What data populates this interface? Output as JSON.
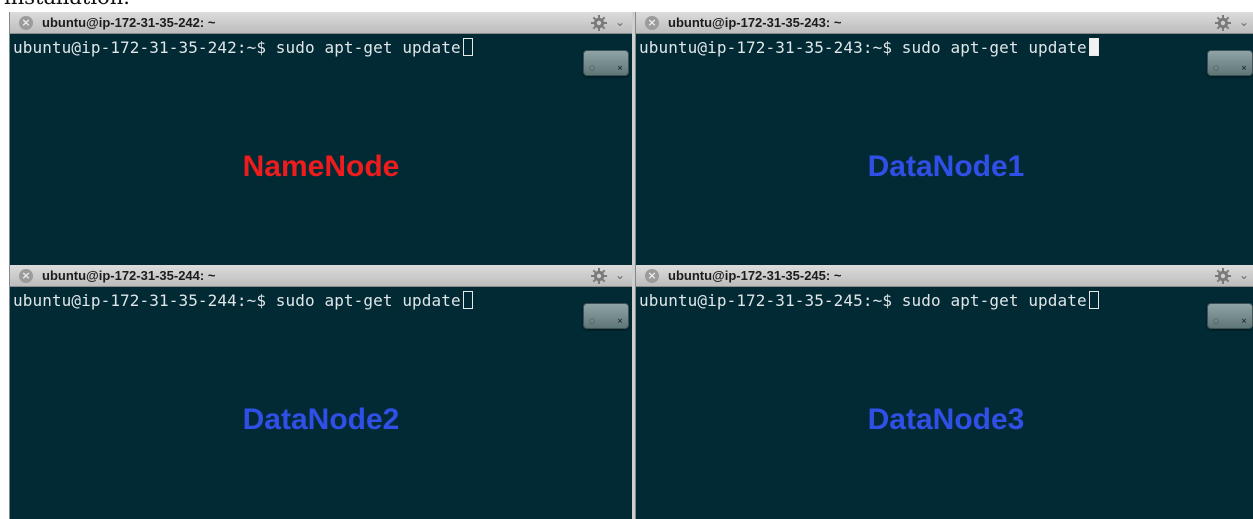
{
  "caption": {
    "partial_text": "installation."
  },
  "panes": [
    {
      "title": "ubuntu@ip-172-31-35-242: ~",
      "prompt": "ubuntu@ip-172-31-35-242:~$",
      "command": "sudo apt-get update",
      "cursor": "outline",
      "label": "NameNode",
      "label_color": "#ee1c1c"
    },
    {
      "title": "ubuntu@ip-172-31-35-243: ~",
      "prompt": "ubuntu@ip-172-31-35-243:~$",
      "command": "sudo apt-get update",
      "cursor": "filled",
      "label": "DataNode1",
      "label_color": "#2f4fe6"
    },
    {
      "title": "ubuntu@ip-172-31-35-244: ~",
      "prompt": "ubuntu@ip-172-31-35-244:~$",
      "command": "sudo apt-get update",
      "cursor": "outline",
      "label": "DataNode2",
      "label_color": "#2f4fe6"
    },
    {
      "title": "ubuntu@ip-172-31-35-245: ~",
      "prompt": "ubuntu@ip-172-31-35-245:~$",
      "command": "sudo apt-get update",
      "cursor": "outline",
      "label": "DataNode3",
      "label_color": "#2f4fe6"
    }
  ],
  "icons": {
    "close": "close-icon",
    "settings": "gear-icon",
    "menu": "chevron-down-icon"
  },
  "colors": {
    "terminal_bg": "#022a35",
    "terminal_fg": "#dfe6e8",
    "titlebar": "#c8c8c8"
  }
}
